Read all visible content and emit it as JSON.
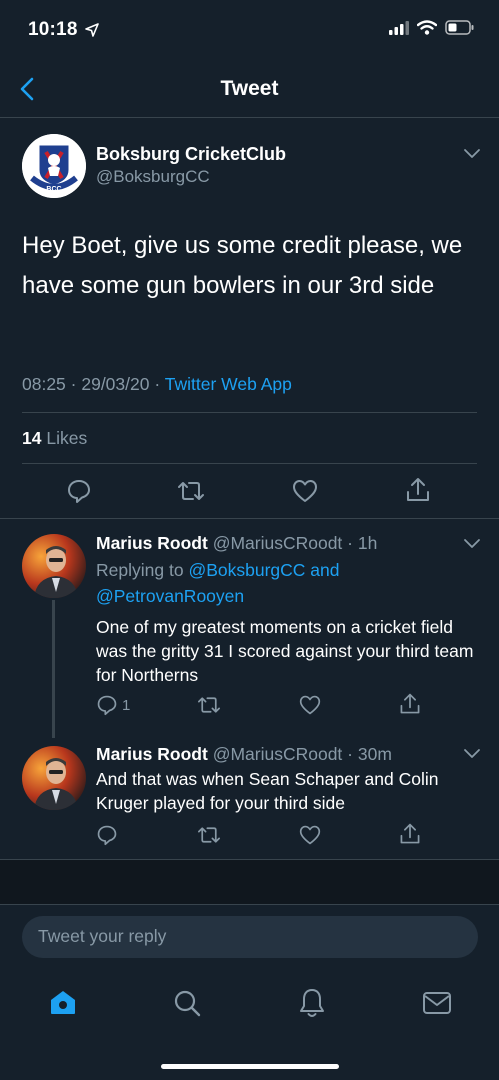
{
  "status_bar": {
    "time": "10:18"
  },
  "nav": {
    "title": "Tweet"
  },
  "main_tweet": {
    "name": "Boksburg CricketClub",
    "handle": "@BoksburgCC",
    "avatar_initials": "BCC",
    "text": "Hey Boet, give us some credit please, we have some gun bowlers in our 3rd side",
    "time": "08:25",
    "date": "29/03/20",
    "source": "Twitter Web App",
    "likes_count": "14",
    "likes_label": "Likes"
  },
  "replies": [
    {
      "name": "Marius Roodt",
      "handle": "@MariusCRoodt",
      "age": "1h",
      "replying_prefix": "Replying to",
      "replying_to_1": "@BoksburgCC",
      "replying_and": "and",
      "replying_to_2": "@PetrovanRooyen",
      "text": "One of my greatest moments on a cricket field was the gritty 31 I scored against your third team for Northerns",
      "reply_count": "1"
    },
    {
      "name": "Marius Roodt",
      "handle": "@MariusCRoodt",
      "age": "30m",
      "text": "And that was when Sean Schaper and Colin Kruger played for your third side"
    }
  ],
  "composer": {
    "placeholder": "Tweet your reply"
  },
  "colors": {
    "background": "#15202b",
    "accent": "#1da1f2",
    "muted": "#8899a6",
    "divider": "#38444d"
  }
}
